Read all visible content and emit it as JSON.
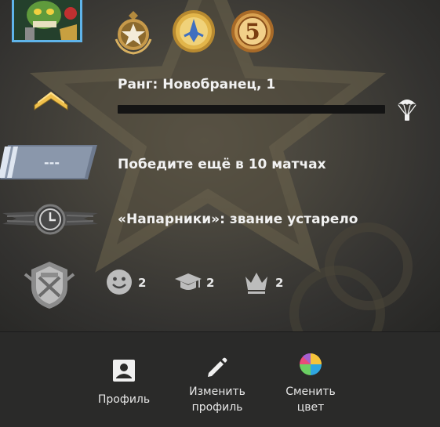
{
  "rank": {
    "title": "Ранг: Новобранец, 1",
    "xp_progress": 0
  },
  "competitive": {
    "text": "Победите ещё в 10 матчах",
    "badge_text": "---"
  },
  "wingman": {
    "text": "«Напарники»: звание устарело"
  },
  "medals": [
    "five-year-service-star-medal",
    "operation-coin-medal",
    "number-5-coin-medal"
  ],
  "commendations": {
    "friendly": 2,
    "teacher": 2,
    "leader": 2
  },
  "actions": {
    "profile_label": "Профиль",
    "edit_line1": "Изменить",
    "edit_line2": "профиль",
    "color_line1": "Сменить",
    "color_line2": "цвет"
  },
  "colors": {
    "avatar_border": "#5fb4ea",
    "rank_chevron": "#e0b040",
    "background": "#47443c"
  }
}
